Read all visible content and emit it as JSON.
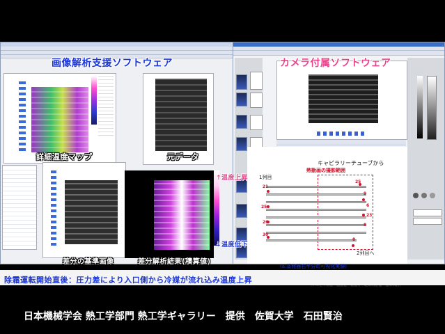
{
  "overlays": {
    "left_title": "画像解析支援ソフトウェア",
    "right_title": "カメラ付属ソフトウェア",
    "detail_map": "詳細温度マップ",
    "original_data": "元データ",
    "reference_image": "差分の基準画像",
    "diff_result": "差分解析結果(積算値)",
    "temp_up": "↑温度上昇",
    "temp_down": "↓温度低下",
    "caption": "除霜運転開始直後：圧力差により入口側から冷媒が流れ込み温度上昇"
  },
  "diagram": {
    "capillary": "キャピラリーチューブから",
    "row1": "1列目",
    "heat_area": "熱動画の撮影範囲",
    "to_row2": "2列目へ",
    "footnote": "(a.蒸発器右半分の可視化実験)",
    "numbers": [
      "21",
      "25",
      "26",
      "30",
      "23",
      "8",
      "9",
      "6",
      "25",
      "8"
    ]
  },
  "credit": "日本機械学会 熱工学部門 熱工学ギャラリー　提供　佐賀大学　石田賢治",
  "bottom_note": "(ナルと平滑値・温度値・乾湿等・乾球(I期)温・温球(I期))",
  "colors": {
    "blue_overlay": "#1a35d8",
    "pink_overlay": "#e8458c",
    "red": "#d1102a"
  }
}
